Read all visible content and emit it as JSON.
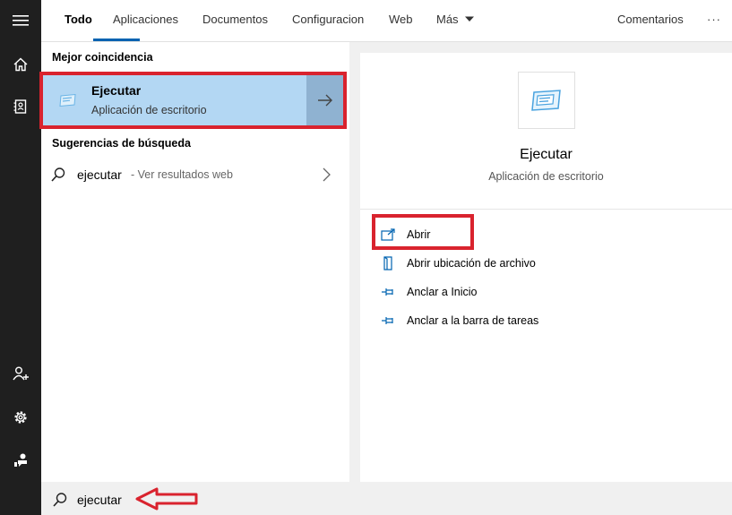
{
  "nav_rail": {
    "items": [
      {
        "icon": "hamburger-menu-icon"
      },
      {
        "icon": "home-icon"
      },
      {
        "icon": "notebook-icon"
      },
      {
        "icon": "person-add-icon"
      },
      {
        "icon": "gear-icon"
      },
      {
        "icon": "feedback-icon"
      }
    ]
  },
  "tabs": [
    {
      "label": "Todo",
      "active": true
    },
    {
      "label": "Aplicaciones"
    },
    {
      "label": "Documentos"
    },
    {
      "label": "Configuracion"
    },
    {
      "label": "Web"
    },
    {
      "label": "Más"
    }
  ],
  "header": {
    "feedback_label": "Comentarios",
    "more_label": "···"
  },
  "results": {
    "best_match_heading": "Mejor coincidencia",
    "best_match": {
      "title": "Ejecutar",
      "subtitle": "Aplicación de escritorio"
    },
    "suggestions_heading": "Sugerencias de búsqueda",
    "suggestion": {
      "query": "ejecutar",
      "suffix": " - Ver resultados web"
    }
  },
  "preview": {
    "title": "Ejecutar",
    "subtitle": "Aplicación de escritorio",
    "actions": [
      {
        "label": "Abrir",
        "icon": "open-icon"
      },
      {
        "label": "Abrir ubicación de archivo",
        "icon": "file-location-icon"
      },
      {
        "label": "Anclar a Inicio",
        "icon": "pin-icon"
      },
      {
        "label": "Anclar a la barra de tareas",
        "icon": "pin-icon"
      }
    ]
  },
  "search": {
    "value": "ejecutar"
  },
  "colors": {
    "accent": "#0063b1",
    "highlight": "#d9232e",
    "selection": "#b3d7f3"
  }
}
